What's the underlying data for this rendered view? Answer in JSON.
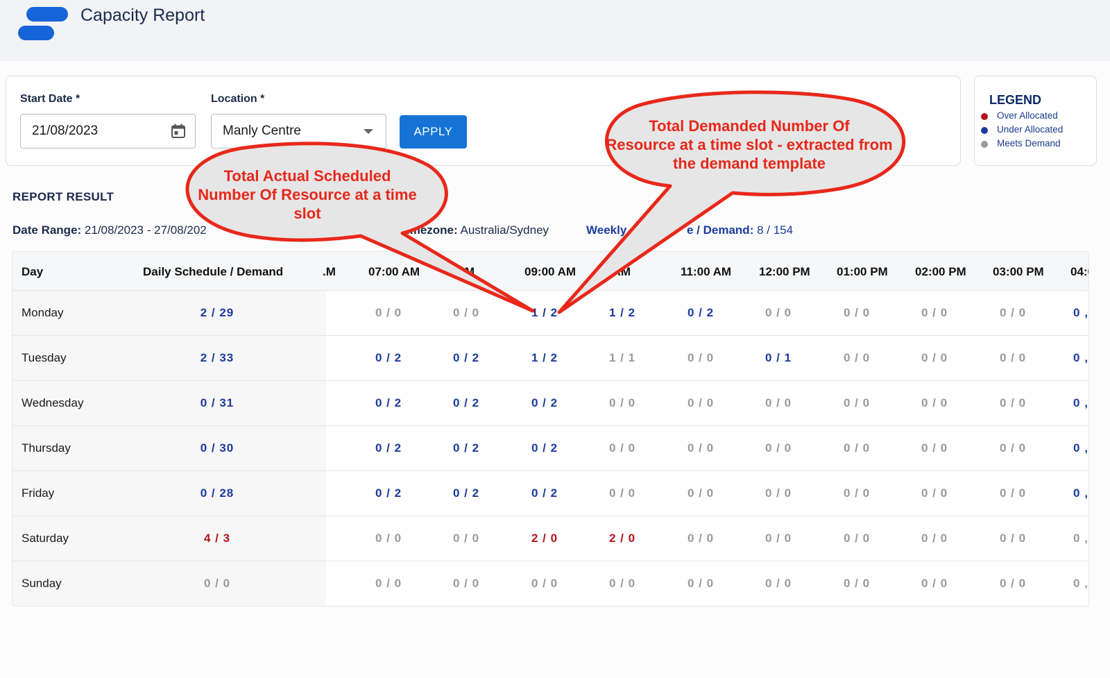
{
  "header": {
    "title": "Capacity Report"
  },
  "filters": {
    "start_date_label": "Start Date *",
    "start_date_value": "21/08/2023",
    "location_label": "Location *",
    "location_value": "Manly Centre",
    "apply_label": "APPLY"
  },
  "legend": {
    "title": "LEGEND",
    "items": [
      {
        "label": "Over Allocated",
        "color": "#b3141c"
      },
      {
        "label": "Under Allocated",
        "color": "#1b3b9e"
      },
      {
        "label": "Meets Demand",
        "color": "#9a9a9a"
      }
    ]
  },
  "report": {
    "title": "REPORT RESULT",
    "date_range_label": "Date Range:",
    "date_range_value": "21/08/2023 - 27/08/202",
    "timezone_label": "imezone:",
    "timezone_value": "Australia/Sydney",
    "weekly_label_a": "Weekly",
    "weekly_label_b": "e / Demand:",
    "weekly_value": "8 / 154"
  },
  "table": {
    "headers": {
      "day": "Day",
      "daily": "Daily Schedule / Demand",
      "slots": [
        ".M",
        "07:00 AM",
        "0    AM",
        "09:00 AM",
        "    0 AM",
        "11:00 AM",
        "12:00 PM",
        "01:00 PM",
        "02:00 PM",
        "03:00 PM",
        "04:0("
      ]
    },
    "rows": [
      {
        "day": "Monday",
        "daily": {
          "text": "2 / 29",
          "status": "under"
        },
        "slots": [
          {
            "text": "0 / 0",
            "status": "meets"
          },
          {
            "text": "0 / 0",
            "status": "meets"
          },
          {
            "text": "1 / 2",
            "status": "under"
          },
          {
            "text": "1 / 2",
            "status": "under"
          },
          {
            "text": "0 / 2",
            "status": "under"
          },
          {
            "text": "0 / 0",
            "status": "meets"
          },
          {
            "text": "0 / 0",
            "status": "meets"
          },
          {
            "text": "0 / 0",
            "status": "meets"
          },
          {
            "text": "0 / 0",
            "status": "meets"
          },
          {
            "text": "0 ,",
            "status": "under"
          }
        ]
      },
      {
        "day": "Tuesday",
        "daily": {
          "text": "2 / 33",
          "status": "under"
        },
        "slots": [
          {
            "text": "0 / 2",
            "status": "under"
          },
          {
            "text": "0 / 2",
            "status": "under"
          },
          {
            "text": "1 / 2",
            "status": "under"
          },
          {
            "text": "1 / 1",
            "status": "meets"
          },
          {
            "text": "0 / 0",
            "status": "meets"
          },
          {
            "text": "0 / 1",
            "status": "under"
          },
          {
            "text": "0 / 0",
            "status": "meets"
          },
          {
            "text": "0 / 0",
            "status": "meets"
          },
          {
            "text": "0 / 0",
            "status": "meets"
          },
          {
            "text": "0 ,",
            "status": "under"
          }
        ]
      },
      {
        "day": "Wednesday",
        "daily": {
          "text": "0 / 31",
          "status": "under"
        },
        "slots": [
          {
            "text": "0 / 2",
            "status": "under"
          },
          {
            "text": "0 / 2",
            "status": "under"
          },
          {
            "text": "0 / 2",
            "status": "under"
          },
          {
            "text": "0 / 0",
            "status": "meets"
          },
          {
            "text": "0 / 0",
            "status": "meets"
          },
          {
            "text": "0 / 0",
            "status": "meets"
          },
          {
            "text": "0 / 0",
            "status": "meets"
          },
          {
            "text": "0 / 0",
            "status": "meets"
          },
          {
            "text": "0 / 0",
            "status": "meets"
          },
          {
            "text": "0 ,",
            "status": "under"
          }
        ]
      },
      {
        "day": "Thursday",
        "daily": {
          "text": "0 / 30",
          "status": "under"
        },
        "slots": [
          {
            "text": "0 / 2",
            "status": "under"
          },
          {
            "text": "0 / 2",
            "status": "under"
          },
          {
            "text": "0 / 2",
            "status": "under"
          },
          {
            "text": "0 / 0",
            "status": "meets"
          },
          {
            "text": "0 / 0",
            "status": "meets"
          },
          {
            "text": "0 / 0",
            "status": "meets"
          },
          {
            "text": "0 / 0",
            "status": "meets"
          },
          {
            "text": "0 / 0",
            "status": "meets"
          },
          {
            "text": "0 / 0",
            "status": "meets"
          },
          {
            "text": "0 ,",
            "status": "under"
          }
        ]
      },
      {
        "day": "Friday",
        "daily": {
          "text": "0 / 28",
          "status": "under"
        },
        "slots": [
          {
            "text": "0 / 2",
            "status": "under"
          },
          {
            "text": "0 / 2",
            "status": "under"
          },
          {
            "text": "0 / 2",
            "status": "under"
          },
          {
            "text": "0 / 0",
            "status": "meets"
          },
          {
            "text": "0 / 0",
            "status": "meets"
          },
          {
            "text": "0 / 0",
            "status": "meets"
          },
          {
            "text": "0 / 0",
            "status": "meets"
          },
          {
            "text": "0 / 0",
            "status": "meets"
          },
          {
            "text": "0 / 0",
            "status": "meets"
          },
          {
            "text": "0 ,",
            "status": "under"
          }
        ]
      },
      {
        "day": "Saturday",
        "daily": {
          "text": "4 / 3",
          "status": "over"
        },
        "slots": [
          {
            "text": "0 / 0",
            "status": "meets"
          },
          {
            "text": "0 / 0",
            "status": "meets"
          },
          {
            "text": "2 / 0",
            "status": "over"
          },
          {
            "text": "2 / 0",
            "status": "over"
          },
          {
            "text": "0 / 0",
            "status": "meets"
          },
          {
            "text": "0 / 0",
            "status": "meets"
          },
          {
            "text": "0 / 0",
            "status": "meets"
          },
          {
            "text": "0 / 0",
            "status": "meets"
          },
          {
            "text": "0 / 0",
            "status": "meets"
          },
          {
            "text": "0 ,",
            "status": "meets"
          }
        ]
      },
      {
        "day": "Sunday",
        "daily": {
          "text": "0 / 0",
          "status": "meets"
        },
        "slots": [
          {
            "text": "0 / 0",
            "status": "meets"
          },
          {
            "text": "0 / 0",
            "status": "meets"
          },
          {
            "text": "0 / 0",
            "status": "meets"
          },
          {
            "text": "0 / 0",
            "status": "meets"
          },
          {
            "text": "0 / 0",
            "status": "meets"
          },
          {
            "text": "0 / 0",
            "status": "meets"
          },
          {
            "text": "0 / 0",
            "status": "meets"
          },
          {
            "text": "0 / 0",
            "status": "meets"
          },
          {
            "text": "0 / 0",
            "status": "meets"
          },
          {
            "text": "0 ,",
            "status": "meets"
          }
        ]
      }
    ]
  },
  "callouts": {
    "actual": [
      "Total Actual Scheduled",
      "Number Of Resource at a time",
      "slot"
    ],
    "demanded": [
      "Total Demanded Number Of",
      "Resource at a time slot - extracted from",
      "the demand template"
    ]
  },
  "colors": {
    "accent": "#1673d6",
    "callout": "#e8281b",
    "callout_fill": "#e6e6e6"
  }
}
